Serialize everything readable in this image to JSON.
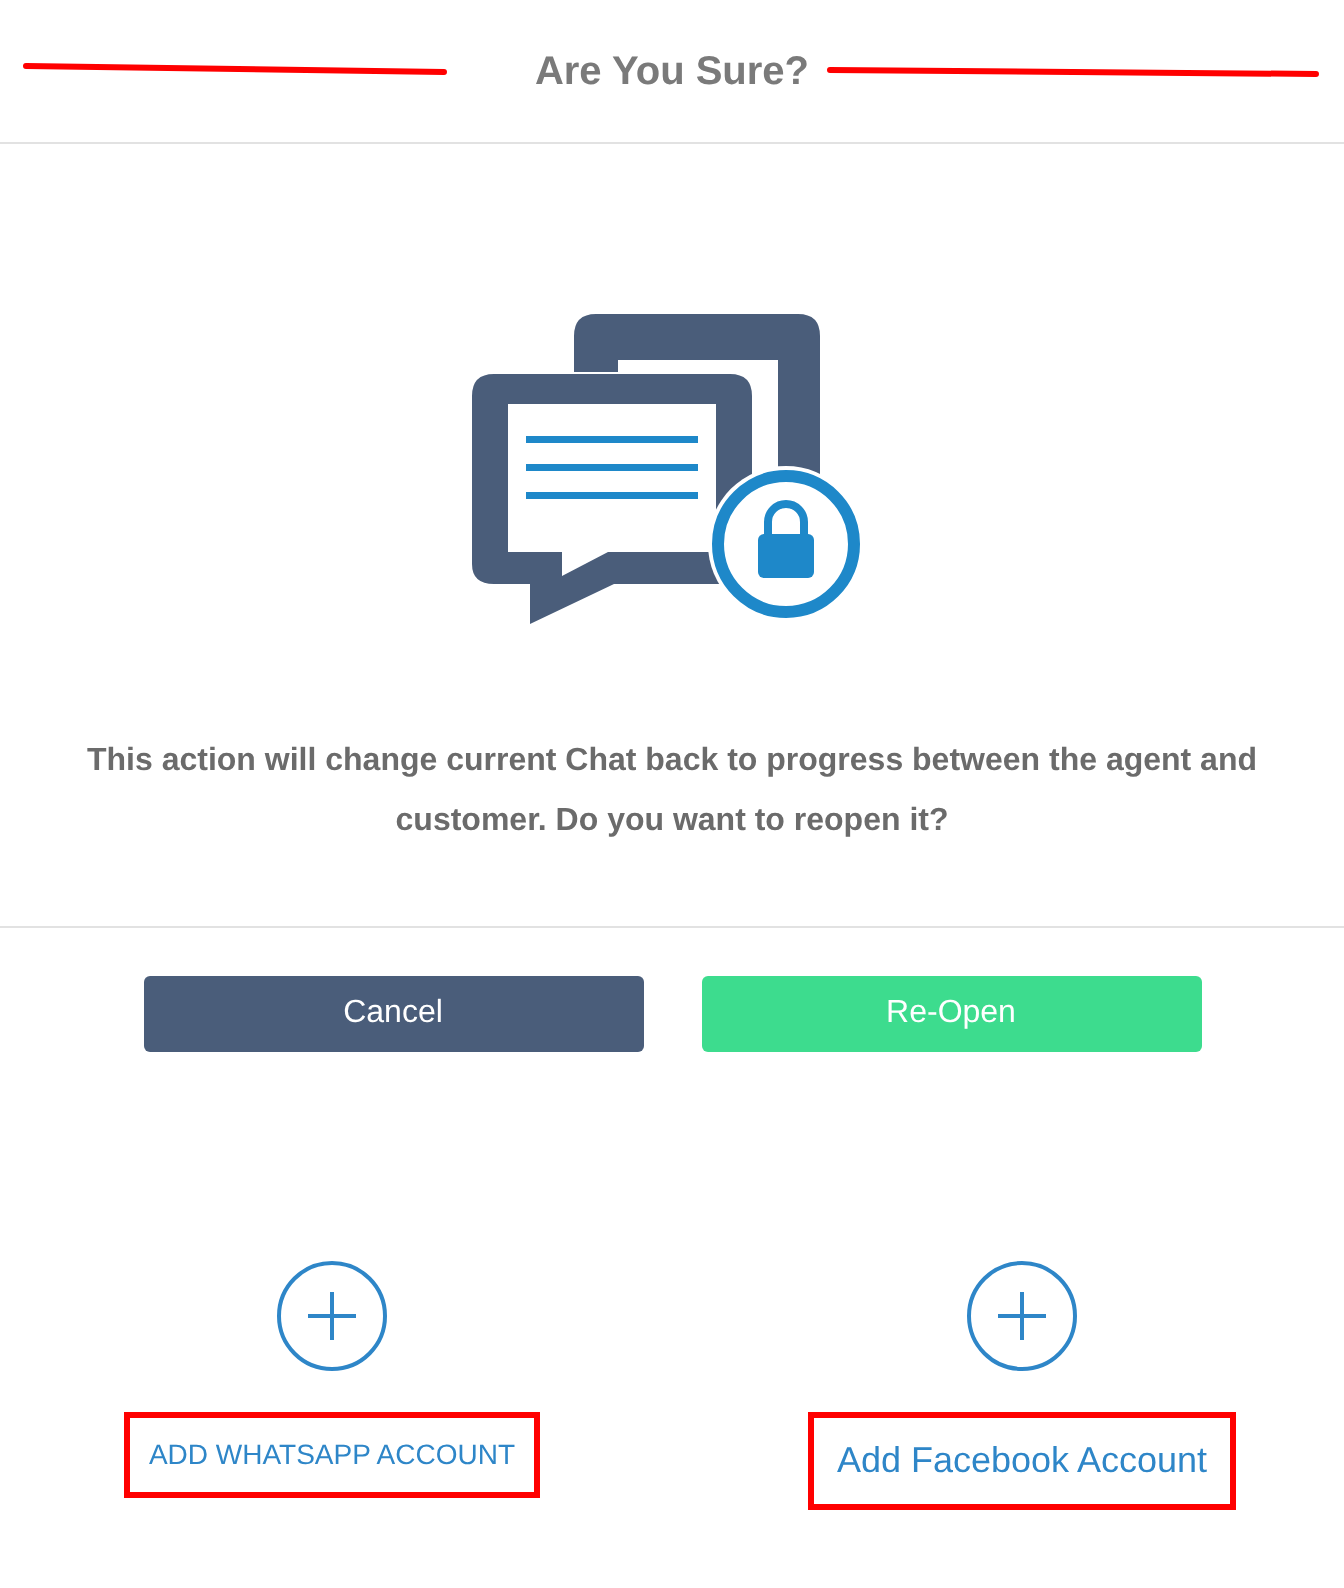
{
  "dialog": {
    "title": "Are You Sure?",
    "title_marked": true,
    "message": "This action will change current Chat back to progress between the agent and customer. Do you want to reopen it?",
    "buttons": [
      {
        "label": "Cancel",
        "kind": "secondary"
      },
      {
        "label": "Re-Open",
        "kind": "primary"
      }
    ]
  },
  "accounts": [
    {
      "label": "ADD WHATSAPP ACCOUNT",
      "highlighted": true
    },
    {
      "label": "Add Facebook Account",
      "highlighted": true
    }
  ]
}
